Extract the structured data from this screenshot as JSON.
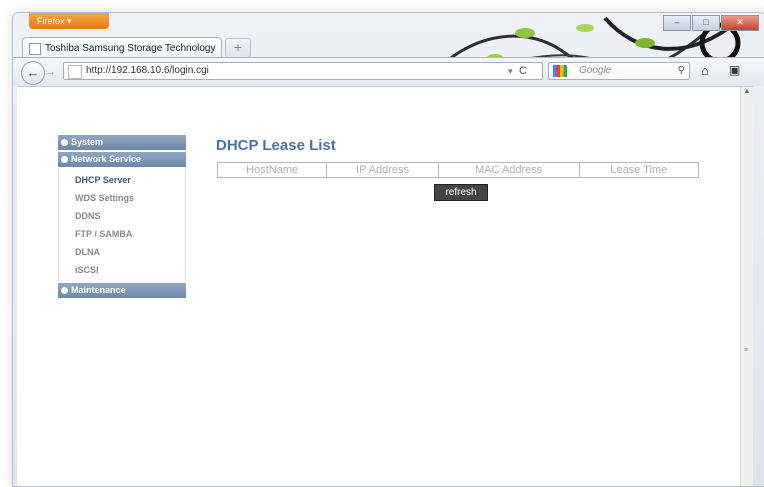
{
  "browser": {
    "app_button": "Firefox",
    "tab_title": "Toshiba Samsung Storage Technology",
    "new_tab": "+",
    "url": "http://192.168.10.6/login.cgi",
    "search_placeholder": "Google",
    "window_controls": {
      "minimize": "–",
      "maximize": "□",
      "close": "✕"
    }
  },
  "sidebar": {
    "system": "System",
    "network_service": "Network Service",
    "items": [
      {
        "label": "DHCP Server"
      },
      {
        "label": "WDS Settings"
      },
      {
        "label": "DDNS"
      },
      {
        "label": "FTP / SAMBA"
      },
      {
        "label": "DLNA"
      },
      {
        "label": "iSCSI"
      }
    ],
    "maintenance": "Maintenance"
  },
  "main": {
    "title": "DHCP Lease List",
    "columns": [
      "HostName",
      "IP Address",
      "MAC Address",
      "Lease Time"
    ],
    "refresh_label": "refresh"
  }
}
